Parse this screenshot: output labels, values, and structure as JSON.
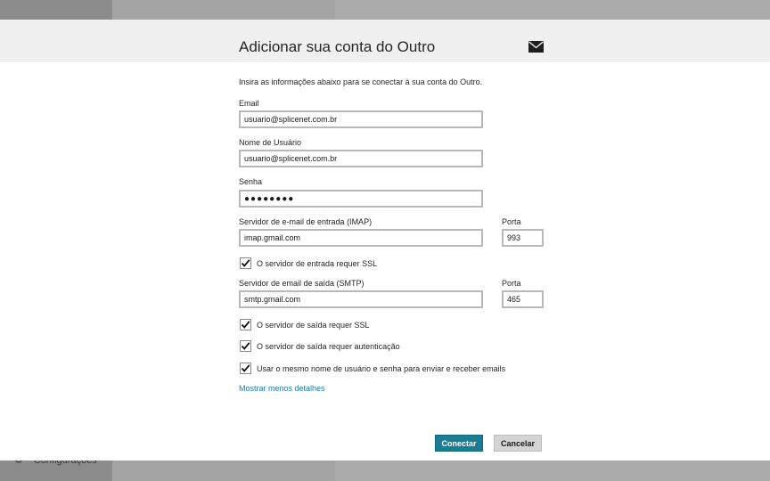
{
  "background": {
    "settings_label": "Configurações",
    "settings_icon": "gear-icon"
  },
  "dialog": {
    "title": "Adicionar sua conta do Outro",
    "header_icon": "mail-icon",
    "intro": "Insira as informações abaixo para se conectar à sua conta do Outro.",
    "email": {
      "label": "Email",
      "value": "usuario@splicenet.com.br"
    },
    "username": {
      "label": "Nome de Usuário",
      "value": "usuario@splicenet.com.br"
    },
    "password": {
      "label": "Senha",
      "value": "●●●●●●●●"
    },
    "incoming": {
      "label": "Servidor de e-mail de entrada (IMAP)",
      "value": "imap.gmail.com",
      "port_label": "Porta",
      "port": "993",
      "ssl_label": "O servidor de entrada requer SSL",
      "ssl_checked": true
    },
    "outgoing": {
      "label": "Servidor de email de saída (SMTP)",
      "value": "smtp.gmail.com",
      "port_label": "Porta",
      "port": "465",
      "ssl_label": "O servidor de saída requer SSL",
      "ssl_checked": true,
      "auth_label": "O servidor de saída requer autenticação",
      "auth_checked": true,
      "same_creds_label": "Usar o mesmo nome de usuário e senha para enviar e receber emails",
      "same_creds_checked": true
    },
    "less_details_link": "Mostrar menos detalhes",
    "connect_button": "Conectar",
    "cancel_button": "Cancelar"
  },
  "colors": {
    "accent": "#197e93",
    "link": "#1a7ea3",
    "header_bg": "#f0f0f0"
  }
}
